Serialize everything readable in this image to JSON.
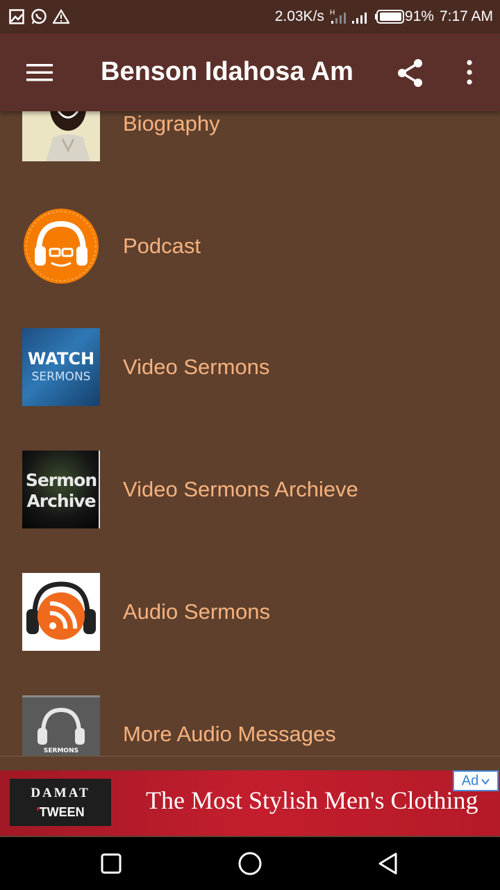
{
  "status_bar": {
    "net_speed": "2.03K/s",
    "net_type": "H",
    "battery": "91%",
    "time": "7:17 AM",
    "icons": [
      "gallery-icon",
      "whatsapp-icon",
      "warning-icon",
      "signal-icon",
      "battery-icon"
    ]
  },
  "app_bar": {
    "title": "Benson Idahosa Am",
    "menu_icon": "hamburger-menu-icon",
    "share_icon": "share-icon",
    "more_icon": "more-vertical-icon",
    "background": "#5c302a"
  },
  "menu_items": [
    {
      "label": "Biography",
      "thumbnail": "biography-portrait"
    },
    {
      "label": "Podcast",
      "thumbnail": "podcast-headphones-logo"
    },
    {
      "label": "Video Sermons",
      "thumbnail": "watch-sermons-image",
      "thumb_text_1": "WATCH",
      "thumb_text_2": "SERMONS"
    },
    {
      "label": "Video Sermons Archieve",
      "thumbnail": "sermon-archive-image",
      "thumb_text_1": "Sermon",
      "thumb_text_2": "Archive"
    },
    {
      "label": "Audio Sermons",
      "thumbnail": "audio-rss-headphones-image"
    },
    {
      "label": "More Audio Messages",
      "thumbnail": "sermons-headphones-image",
      "thumb_text_1": "SERMONS"
    }
  ],
  "ad": {
    "brand_line1": "DAMAT",
    "brand_line2": "TWEEN",
    "text": "The Most Stylish Men's Clothing",
    "badge": "Ad",
    "background": "#b51a28"
  },
  "nav_bar": {
    "buttons": [
      "recents-square-icon",
      "home-circle-icon",
      "back-triangle-icon"
    ]
  },
  "colors": {
    "page_background": "#5e402d",
    "label_color": "#f7b27e",
    "status_bar": "#4a2b22"
  }
}
